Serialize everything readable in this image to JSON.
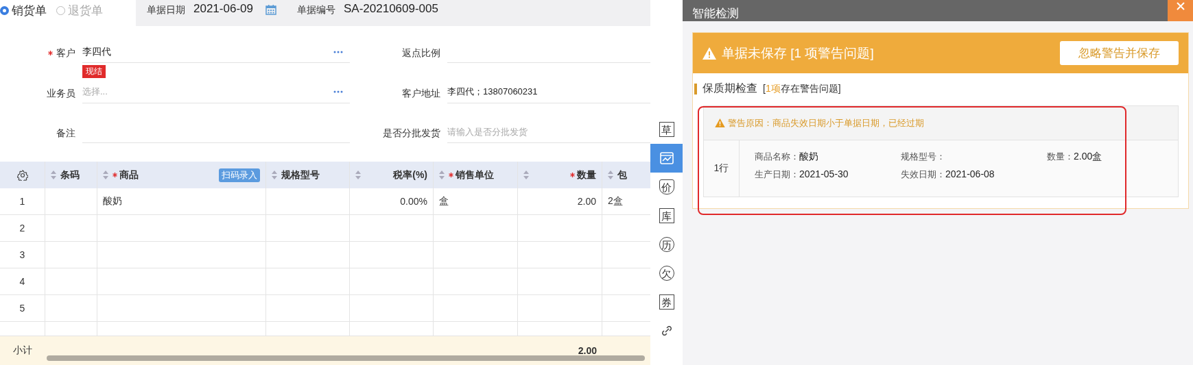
{
  "order_type": [
    {
      "label": "销货单",
      "selected": true
    },
    {
      "label": "退货单",
      "selected": false
    }
  ],
  "header": {
    "date_label": "单据日期",
    "date": "2021-06-09",
    "number_label": "单据编号",
    "number": "SA-20210609-005"
  },
  "form": {
    "left": [
      {
        "label": "客户",
        "required": true,
        "value": "李四代",
        "picker": true,
        "tag": "现结"
      },
      {
        "label": "业务员",
        "required": false,
        "placeholder": "选择...",
        "picker": true
      },
      {
        "label": "备注",
        "required": false,
        "picker": false
      }
    ],
    "right": [
      {
        "label": "返点比例"
      },
      {
        "label": "客户地址",
        "value": "李四代；13807060231"
      },
      {
        "label": "是否分批发货",
        "placeholder": "请输入是否分批发货"
      }
    ]
  },
  "table": {
    "columns": [
      {
        "label": "条码",
        "required": false
      },
      {
        "label": "商品",
        "required": true,
        "action": "扫码录入"
      },
      {
        "label": "规格型号",
        "required": false
      },
      {
        "label": "税率(%)",
        "required": false
      },
      {
        "label": "销售单位",
        "required": true
      },
      {
        "label": "数量",
        "required": true,
        "total": "2.00"
      },
      {
        "label": "包",
        "required": false
      }
    ],
    "rows": [
      {
        "no": "1",
        "cells": [
          null,
          "酸奶",
          null,
          "0.00%",
          "盒",
          "2.00",
          "2盒"
        ]
      },
      {
        "no": "2"
      },
      {
        "no": "3"
      },
      {
        "no": "4"
      },
      {
        "no": "5"
      }
    ],
    "subtotal": {
      "label": "小计"
    }
  },
  "tools": [
    {
      "kind": "char",
      "label": "草",
      "selected": false
    },
    {
      "kind": "chart",
      "selected": true
    },
    {
      "kind": "shield",
      "label": "价",
      "selected": false
    },
    {
      "kind": "char",
      "label": "库",
      "selected": false
    },
    {
      "kind": "cycle",
      "label": "历",
      "selected": false
    },
    {
      "kind": "circle",
      "label": "欠",
      "selected": false
    },
    {
      "kind": "char",
      "label": "券",
      "selected": false
    },
    {
      "kind": "link",
      "selected": false
    }
  ],
  "panel": {
    "title": "智能检测",
    "alert": {
      "title": "单据未保存 [1 项警告问题]",
      "button": "忽略警告并保存"
    },
    "section": {
      "title": "保质期检查",
      "summary": [
        {
          "text": "[",
          "highlight": false
        },
        {
          "text": "1项",
          "highlight": true
        },
        {
          "text": "存在警告问题]",
          "highlight": false
        }
      ]
    },
    "warnings": [
      {
        "reason": "警告原因：商品失效日期小于单据日期，已经过期",
        "row": "1行",
        "fields": [
          {
            "label": "商品名称：",
            "value": "酸奶"
          },
          {
            "label": "规格型号："
          },
          {
            "label": "数量：",
            "value": "2.00盒"
          },
          {
            "label": "生产日期：",
            "value": "2021-05-30"
          },
          {
            "label": "失效日期：",
            "value": "2021-06-08"
          }
        ]
      }
    ]
  }
}
